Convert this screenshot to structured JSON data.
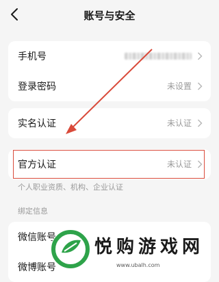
{
  "header": {
    "title": "账号与安全",
    "back_icon": "chevron-left-icon"
  },
  "card_account": {
    "rows": [
      {
        "label": "手机号",
        "value": ""
      },
      {
        "label": "登录密码",
        "value": "未设置"
      }
    ]
  },
  "card_realname": {
    "label": "实名认证",
    "value": "未认证"
  },
  "card_official": {
    "label": "官方认证",
    "value": "未认证"
  },
  "hint_official": "个人职业资质、机构、企业认证",
  "section_bind": "绑定信息",
  "bind_rows": [
    {
      "label": "微信账号"
    },
    {
      "label": "微博账号"
    }
  ],
  "watermark": {
    "title": "悦购游戏网",
    "url": "www.ubalh.com"
  },
  "colors": {
    "accent": "#d94a3a",
    "muted": "#9a9a9a"
  }
}
